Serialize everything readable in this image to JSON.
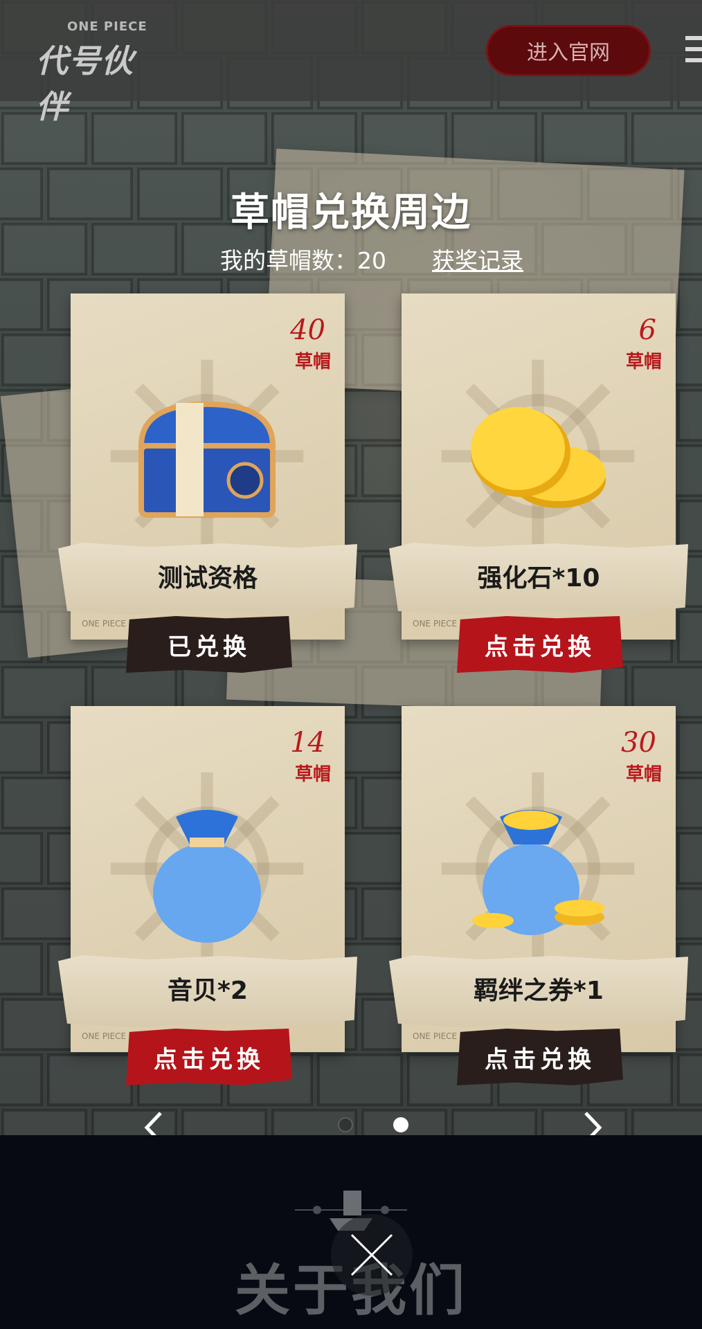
{
  "header": {
    "logo_small": "ONE PIECE",
    "logo_big": "代号伙伴",
    "site_button": "进入官网"
  },
  "main": {
    "title": "草帽兑换周边",
    "my_hats_label": "我的草帽数：",
    "my_hats_count": "20",
    "record_link": "获奖记录"
  },
  "cards": [
    {
      "cost": "40",
      "unit": "草帽",
      "name": "测试资格",
      "button": "已兑换",
      "state": "redeemed",
      "icon": "treasure-chest-icon"
    },
    {
      "cost": "6",
      "unit": "草帽",
      "name": "强化石*10",
      "button": "点击兑换",
      "state": "available",
      "icon": "gold-coins-icon"
    },
    {
      "cost": "14",
      "unit": "草帽",
      "name": "音贝*2",
      "button": "点击兑换",
      "state": "available",
      "icon": "blue-bag-icon"
    },
    {
      "cost": "30",
      "unit": "草帽",
      "name": "羁绊之券*1",
      "button": "点击兑换",
      "state": "unavailable",
      "icon": "coin-bag-icon"
    }
  ],
  "card_small_text": "ONE PIECE",
  "pagination": {
    "pages": 2,
    "current": 2
  },
  "footer": {
    "about": "关于我们"
  },
  "colors": {
    "accent_red": "#b5141b",
    "button_dark": "#2a1e1c",
    "cost_red": "#b81a1d",
    "footer_bg": "#070a12"
  }
}
